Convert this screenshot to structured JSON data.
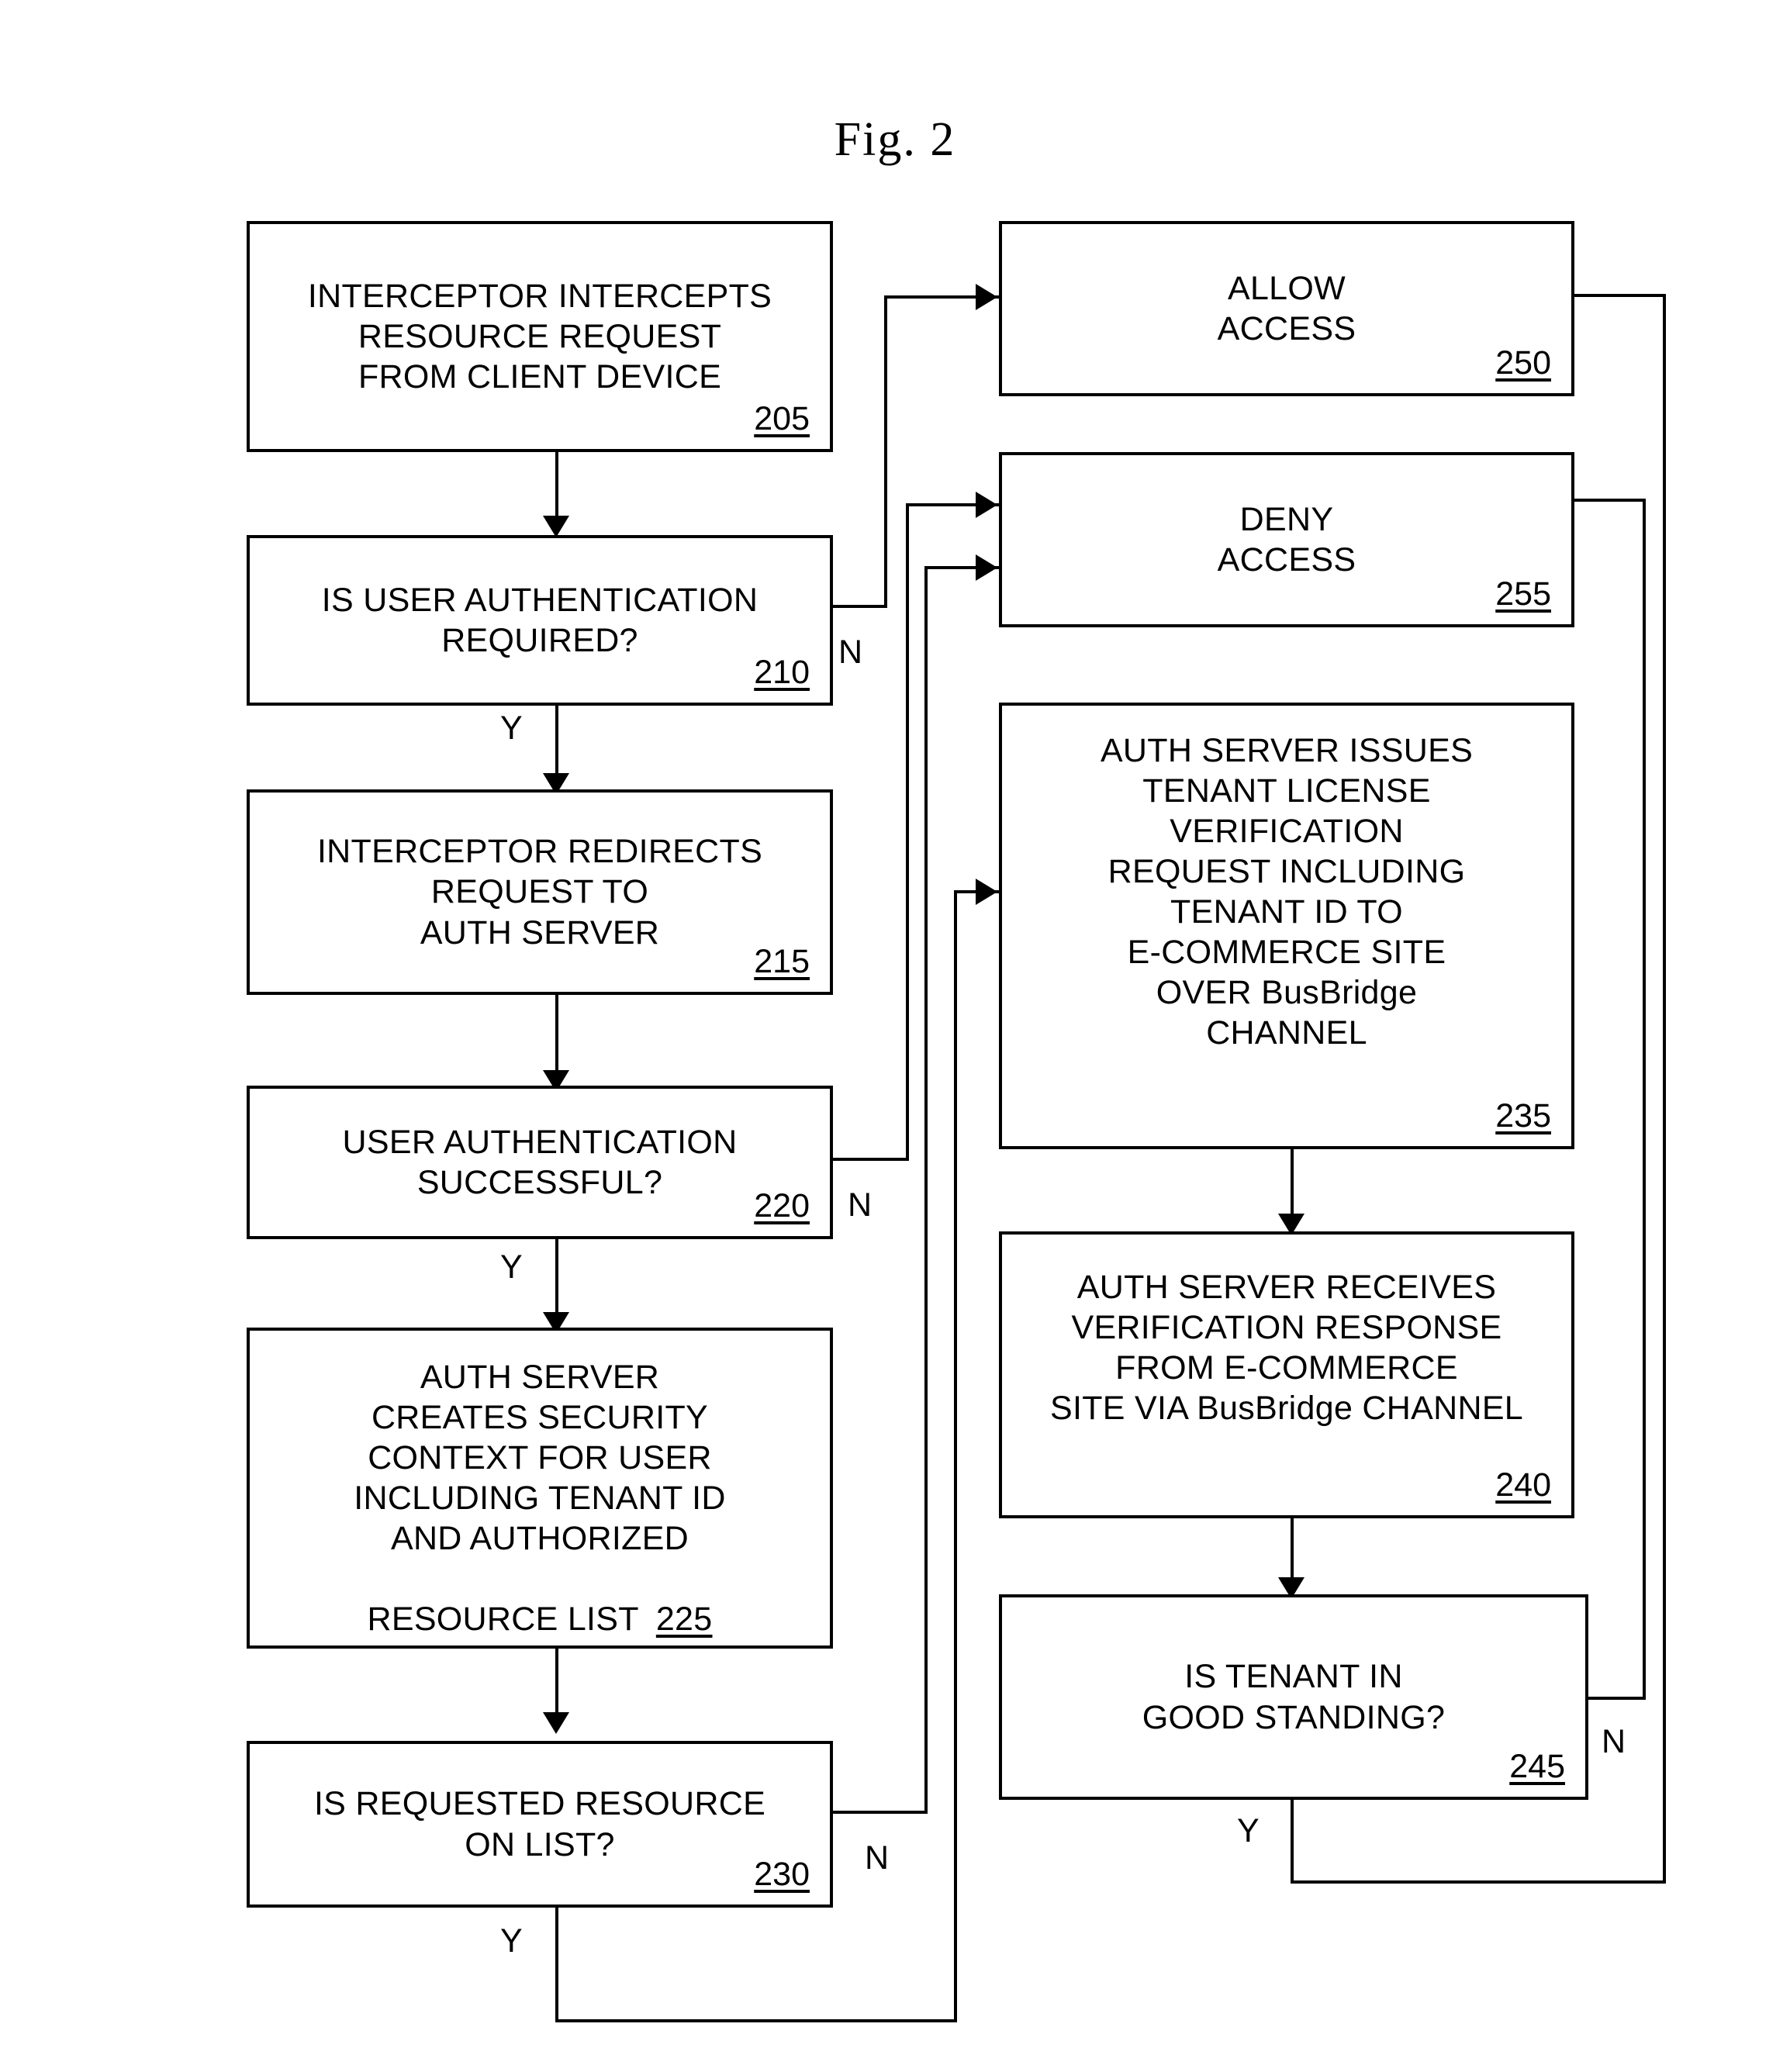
{
  "figure": {
    "title": "Fig. 2",
    "type": "patent-flowchart"
  },
  "nodes": {
    "n205": {
      "text": "INTERCEPTOR INTERCEPTS\nRESOURCE REQUEST\nFROM CLIENT DEVICE",
      "ref": "205"
    },
    "n210": {
      "text": "IS USER AUTHENTICATION\nREQUIRED?",
      "ref": "210"
    },
    "n215": {
      "text": "INTERCEPTOR REDIRECTS\nREQUEST TO\nAUTH SERVER",
      "ref": "215"
    },
    "n220": {
      "text": "USER AUTHENTICATION\nSUCCESSFUL?",
      "ref": "220"
    },
    "n225": {
      "text": "AUTH SERVER\nCREATES SECURITY\nCONTEXT FOR USER\nINCLUDING TENANT ID\nAND AUTHORIZED",
      "last_line": "RESOURCE LIST",
      "ref": "225"
    },
    "n230": {
      "text": "IS REQUESTED RESOURCE\nON LIST?",
      "ref": "230"
    },
    "n235": {
      "text": "AUTH SERVER ISSUES\nTENANT LICENSE\nVERIFICATION\nREQUEST INCLUDING\nTENANT ID TO\nE-COMMERCE SITE\nOVER BusBridge\nCHANNEL",
      "ref": "235"
    },
    "n240": {
      "text": "AUTH SERVER RECEIVES\nVERIFICATION RESPONSE\nFROM E-COMMERCE\nSITE VIA BusBridge CHANNEL",
      "ref": "240"
    },
    "n245": {
      "text": "IS TENANT IN\nGOOD STANDING?",
      "ref": "245"
    },
    "n250": {
      "text": "ALLOW\nACCESS",
      "ref": "250"
    },
    "n255": {
      "text": "DENY\nACCESS",
      "ref": "255"
    }
  },
  "branch_labels": {
    "b210_n": "N",
    "b210_y": "Y",
    "b220_n": "N",
    "b220_y": "Y",
    "b230_n": "N",
    "b230_y": "Y",
    "b245_n": "N",
    "b245_y": "Y"
  },
  "colors": {
    "stroke": "#000000",
    "background": "#ffffff"
  }
}
